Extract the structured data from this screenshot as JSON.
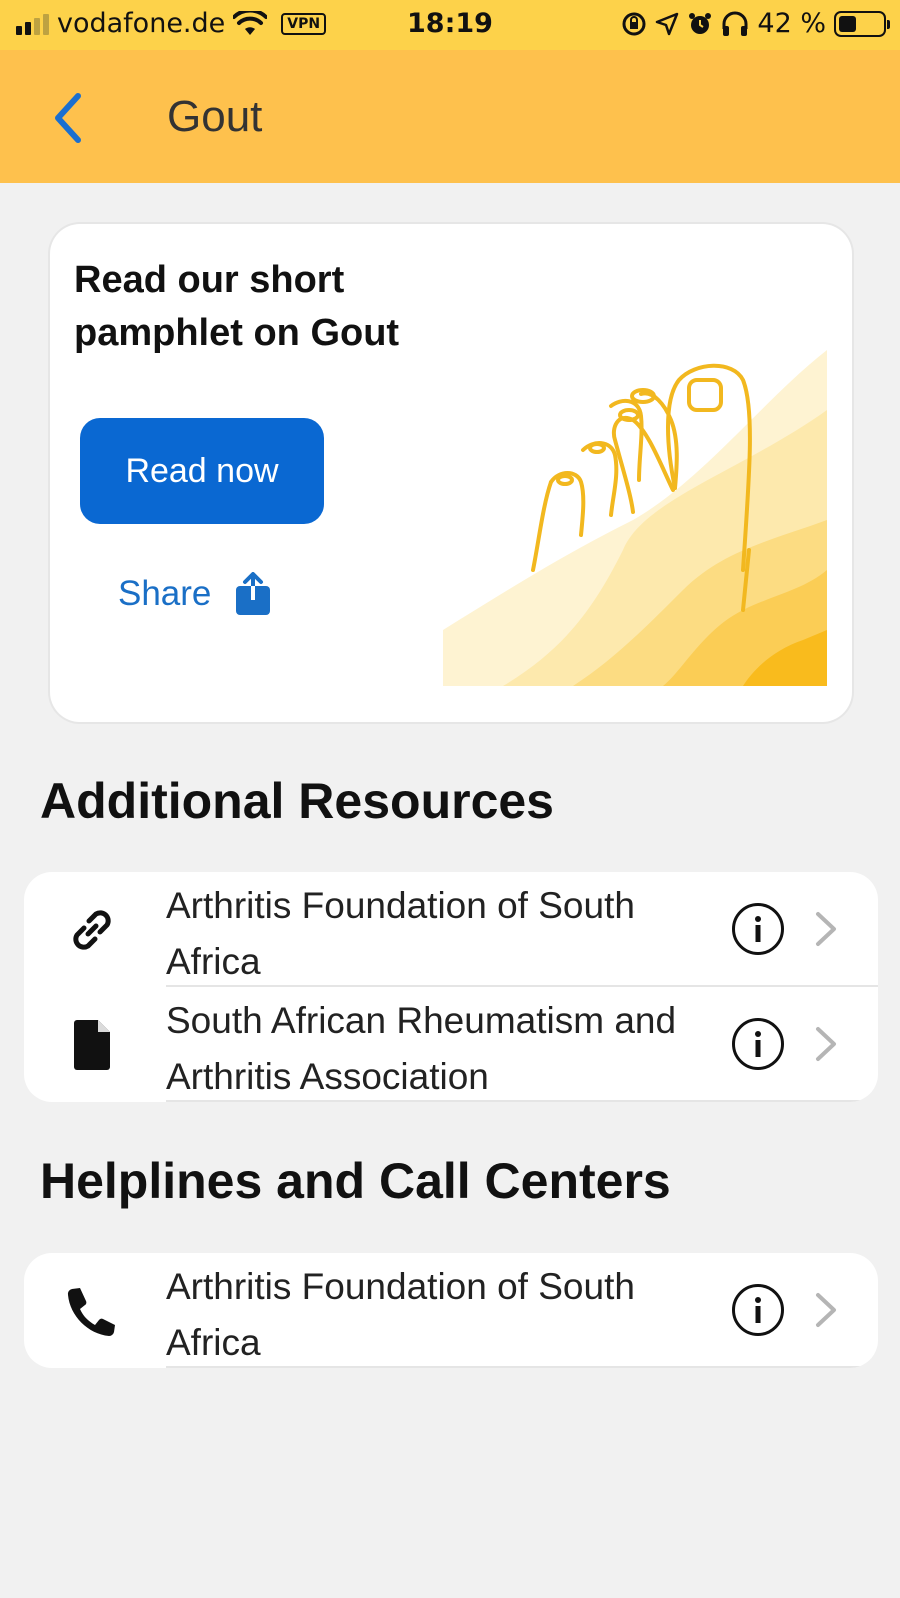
{
  "status_bar": {
    "carrier": "vodafone.de",
    "vpn_label": "VPN",
    "time": "18:19",
    "battery": "42 %",
    "icons": [
      "signal-icon",
      "wifi-icon",
      "lock-rotation-icon",
      "location-icon",
      "alarm-icon",
      "headphones-icon",
      "battery-icon"
    ]
  },
  "header": {
    "title": "Gout",
    "back_icon": "chevron-left-icon"
  },
  "promo": {
    "title": "Read our short pamphlet on Gout",
    "read_button": "Read now",
    "share_label": "Share",
    "share_icon": "share-icon",
    "illustration": "foot-illustration"
  },
  "additional_resources": {
    "heading": "Additional Resources",
    "items": [
      {
        "label": "Arthritis Foundation of South Africa",
        "icon": "link-icon"
      },
      {
        "label": "South African Rheumatism and Arthritis Association",
        "icon": "document-icon"
      }
    ]
  },
  "helplines": {
    "heading": "Helplines and Call Centers",
    "items": [
      {
        "label": "Arthritis Foundation of South Africa",
        "icon": "phone-icon"
      }
    ]
  },
  "colors": {
    "status_bar": "#fdd24a",
    "header": "#fec14d",
    "primary_button": "#0a68d2",
    "link": "#1a6fc6",
    "background": "#f1f1f1"
  }
}
